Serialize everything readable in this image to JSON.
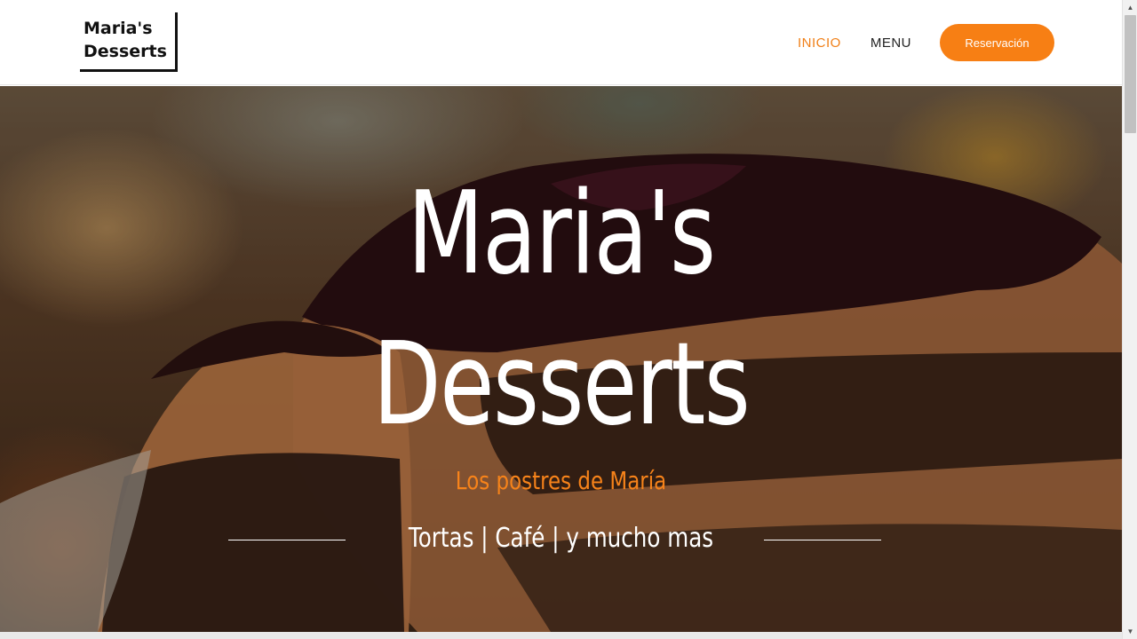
{
  "header": {
    "logo_line1": "Maria's",
    "logo_line2": "Desserts",
    "nav": [
      {
        "label": "INICIO",
        "active": true
      },
      {
        "label": "MENU",
        "active": false
      }
    ],
    "reserve_label": "Reservación"
  },
  "hero": {
    "title_line1": "Maria's",
    "title_line2": "Desserts",
    "subtitle": "Los postres de María",
    "tagline": "Tortas | Café | y mucho mas"
  },
  "colors": {
    "accent": "#f77f14",
    "text_dark": "#222222",
    "hero_text": "#ffffff"
  },
  "icons": {
    "scroll_up": "chevron-up-icon",
    "scroll_down": "chevron-down-icon"
  }
}
